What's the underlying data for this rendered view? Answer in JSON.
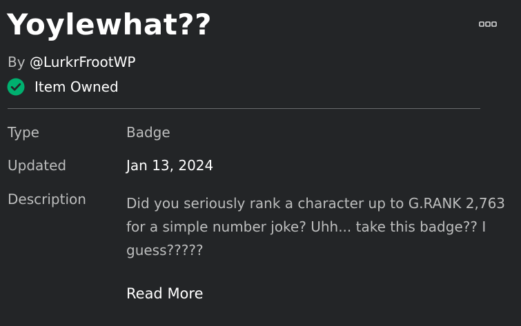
{
  "item": {
    "title": "Yoylewhat??",
    "creator_prefix": "By",
    "creator_handle": "@LurkrFrootWP",
    "owned_status": "Item Owned"
  },
  "details": {
    "type_label": "Type",
    "type_value": "Badge",
    "updated_label": "Updated",
    "updated_value": "Jan 13, 2024",
    "description_label": "Description",
    "description_value": "Did you seriously rank a character up to G.RANK 2,763 for a simple number joke? Uhh... take this badge?? I guess?????",
    "read_more_label": "Read More"
  },
  "icons": {
    "more": "more-options-icon",
    "owned": "check-circle-icon"
  },
  "colors": {
    "background": "#232527",
    "primary_text": "#ffffff",
    "secondary_text": "#bdbebe",
    "owned_green": "#00b06f",
    "divider": "#6b6d6f"
  }
}
